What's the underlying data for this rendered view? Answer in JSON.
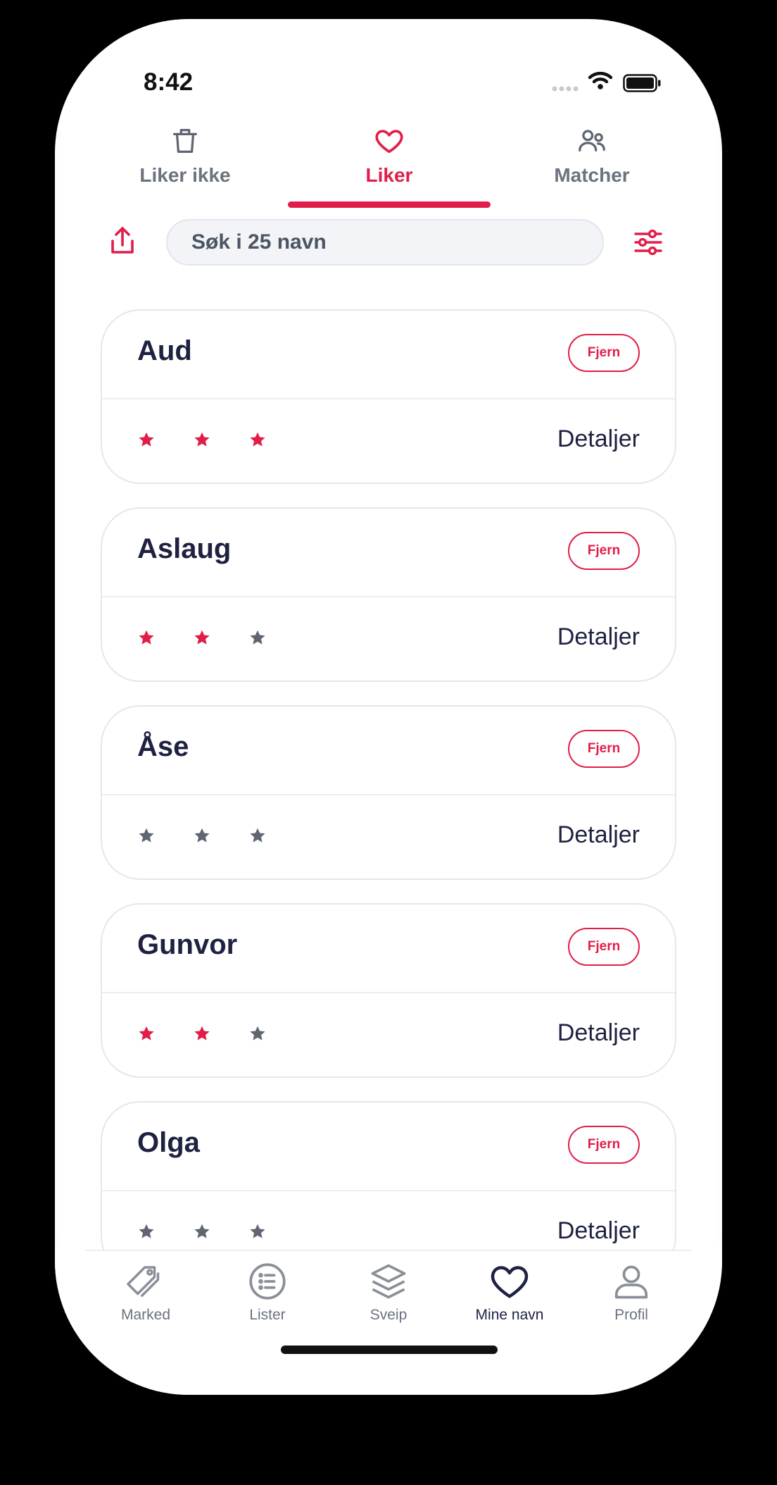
{
  "status_bar": {
    "time": "8:42"
  },
  "tabs": [
    {
      "label": "Liker ikke",
      "icon": "trash-icon",
      "active": false
    },
    {
      "label": "Liker",
      "icon": "heart-icon",
      "active": true
    },
    {
      "label": "Matcher",
      "icon": "people-icon",
      "active": false
    }
  ],
  "search": {
    "placeholder": "Søk i 25 navn",
    "value": ""
  },
  "colors": {
    "accent": "#e11d48",
    "star_off": "#5f6672",
    "text_dark": "#1e2240",
    "muted": "#6b7280"
  },
  "names": [
    {
      "name": "Aud",
      "rating": 3,
      "remove_label": "Fjern",
      "details_label": "Detaljer"
    },
    {
      "name": "Aslaug",
      "rating": 2,
      "remove_label": "Fjern",
      "details_label": "Detaljer"
    },
    {
      "name": "Åse",
      "rating": 0,
      "remove_label": "Fjern",
      "details_label": "Detaljer"
    },
    {
      "name": "Gunvor",
      "rating": 2,
      "remove_label": "Fjern",
      "details_label": "Detaljer"
    },
    {
      "name": "Olga",
      "rating": 0,
      "remove_label": "Fjern",
      "details_label": "Detaljer"
    }
  ],
  "bottom_nav": [
    {
      "label": "Marked",
      "icon": "tag-icon",
      "active": false
    },
    {
      "label": "Lister",
      "icon": "list-icon",
      "active": false
    },
    {
      "label": "Sveip",
      "icon": "layers-icon",
      "active": false
    },
    {
      "label": "Mine navn",
      "icon": "heart-icon",
      "active": true
    },
    {
      "label": "Profil",
      "icon": "user-icon",
      "active": false
    }
  ]
}
